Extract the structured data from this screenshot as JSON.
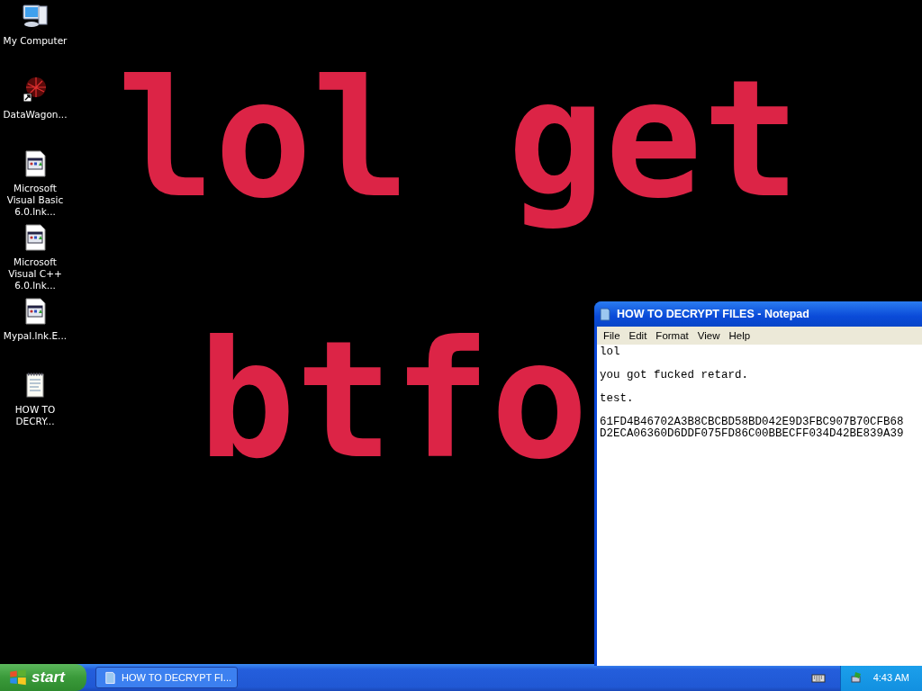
{
  "desktop": {
    "wallpaper_lines": [
      "lol get",
      "btfo"
    ],
    "icons": [
      {
        "kind": "computer",
        "label": "My Computer"
      },
      {
        "kind": "shortcut",
        "label": "DataWagon..."
      },
      {
        "kind": "program",
        "label": "Microsoft Visual Basic 6.0.lnk..."
      },
      {
        "kind": "program",
        "label": "Microsoft Visual C++ 6.0.lnk..."
      },
      {
        "kind": "program",
        "label": "Mypal.lnk.E..."
      },
      {
        "kind": "textfile",
        "label": "HOW TO DECRY..."
      }
    ]
  },
  "notepad": {
    "title": "HOW TO DECRYPT FILES - Notepad",
    "menu": [
      "File",
      "Edit",
      "Format",
      "View",
      "Help"
    ],
    "paragraphs": [
      [
        "lol"
      ],
      [
        "you got fucked retard."
      ],
      [
        "test."
      ],
      [
        "61FD4B46702A3B8CBCBD58BD042E9D3FBC907B70CFB68",
        "D2ECA06360D6DDF075FD86C00BBECFF034D42BE839A39"
      ]
    ]
  },
  "taskbar": {
    "start": "start",
    "tasks": [
      {
        "label": "HOW TO DECRYPT FI...",
        "selected": false
      }
    ],
    "clock": "4:43 AM"
  }
}
